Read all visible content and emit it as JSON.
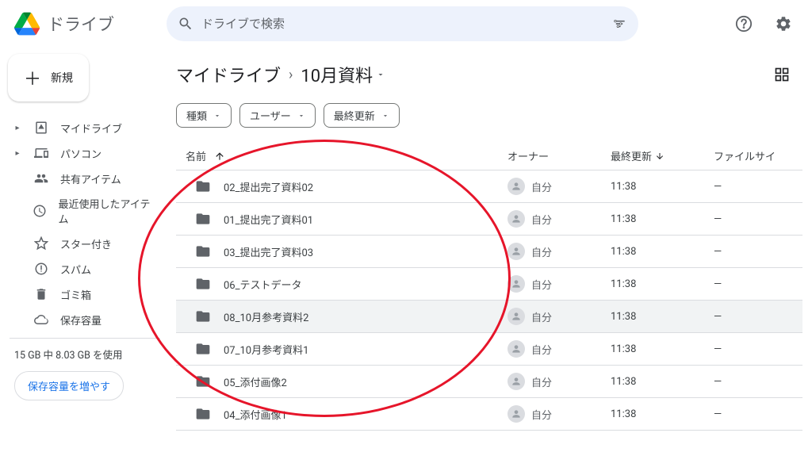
{
  "header": {
    "app_name": "ドライブ",
    "search_placeholder": "ドライブで検索"
  },
  "sidebar": {
    "new_label": "新規",
    "nav": [
      {
        "label": "マイドライブ",
        "icon": "drive",
        "expandable": true
      },
      {
        "label": "パソコン",
        "icon": "devices",
        "expandable": true
      },
      {
        "label": "共有アイテム",
        "icon": "people",
        "expandable": false
      },
      {
        "label": "最近使用したアイテム",
        "icon": "clock",
        "expandable": false
      },
      {
        "label": "スター付き",
        "icon": "star",
        "expandable": false
      },
      {
        "label": "スパム",
        "icon": "spam",
        "expandable": false
      },
      {
        "label": "ゴミ箱",
        "icon": "trash",
        "expandable": false
      },
      {
        "label": "保存容量",
        "icon": "cloud",
        "expandable": false
      }
    ],
    "storage_text": "15 GB 中 8.03 GB を使用",
    "storage_btn": "保存容量を増やす"
  },
  "breadcrumb": {
    "parent": "マイドライブ",
    "current": "10月資料"
  },
  "filters": [
    {
      "label": "種類"
    },
    {
      "label": "ユーザー"
    },
    {
      "label": "最終更新"
    }
  ],
  "table": {
    "headers": {
      "name": "名前",
      "owner": "オーナー",
      "modified": "最終更新",
      "size": "ファイルサイ"
    },
    "rows": [
      {
        "name": "02_提出完了資料02",
        "owner": "自分",
        "modified": "11:38",
        "size": "—"
      },
      {
        "name": "01_提出完了資料01",
        "owner": "自分",
        "modified": "11:38",
        "size": "—"
      },
      {
        "name": "03_提出完了資料03",
        "owner": "自分",
        "modified": "11:38",
        "size": "—"
      },
      {
        "name": "06_テストデータ",
        "owner": "自分",
        "modified": "11:38",
        "size": "—"
      },
      {
        "name": "08_10月参考資料2",
        "owner": "自分",
        "modified": "11:38",
        "size": "—",
        "highlighted": true
      },
      {
        "name": "07_10月参考資料1",
        "owner": "自分",
        "modified": "11:38",
        "size": "—"
      },
      {
        "name": "05_添付画像2",
        "owner": "自分",
        "modified": "11:38",
        "size": "—"
      },
      {
        "name": "04_添付画像1",
        "owner": "自分",
        "modified": "11:38",
        "size": "—"
      }
    ]
  }
}
